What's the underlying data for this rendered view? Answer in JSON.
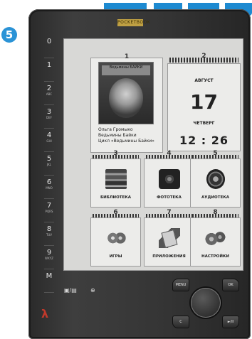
{
  "badge": "5",
  "brand": "POCKETBOOK",
  "keys": [
    {
      "num": "0",
      "sub": ""
    },
    {
      "num": "1",
      "sub": ""
    },
    {
      "num": "2",
      "sub": "ABC"
    },
    {
      "num": "3",
      "sub": "DEF"
    },
    {
      "num": "4",
      "sub": "GHI"
    },
    {
      "num": "5",
      "sub": "JKL"
    },
    {
      "num": "6",
      "sub": "MNO"
    },
    {
      "num": "7",
      "sub": "PQRS"
    },
    {
      "num": "8",
      "sub": "TUV"
    },
    {
      "num": "9",
      "sub": "WXYZ"
    },
    {
      "num": "M",
      "sub": ""
    }
  ],
  "book": {
    "tile_num": "1",
    "cover_title": "Ведьмины БАЙКИ",
    "author": "Ольга Громыко",
    "title": "Ведьмины Байки",
    "series": "Цикл «Ведьмины Байки»"
  },
  "calendar": {
    "tile_num": "2",
    "month": "АВГУСТ",
    "day": "17",
    "weekday": "ЧЕТВЕРГ",
    "time": "12 : 26"
  },
  "apps": [
    {
      "num": "3",
      "label": "БИБЛИОТЕКА",
      "icon": "books-icon"
    },
    {
      "num": "4",
      "label": "ФОТОТЕКА",
      "icon": "camera-icon"
    },
    {
      "num": "5",
      "label": "АУДИОТЕКА",
      "icon": "speaker-icon"
    },
    {
      "num": "6",
      "label": "ИГРЫ",
      "icon": "gamepad-icon"
    },
    {
      "num": "7",
      "label": "ПРИЛОЖЕНИЯ",
      "icon": "notebook-icon"
    },
    {
      "num": "8",
      "label": "НАСТРОЙКИ",
      "icon": "gears-icon"
    }
  ],
  "controls": {
    "menu": "MENU",
    "ok": "OK",
    "c": "C",
    "play": "►/II"
  }
}
